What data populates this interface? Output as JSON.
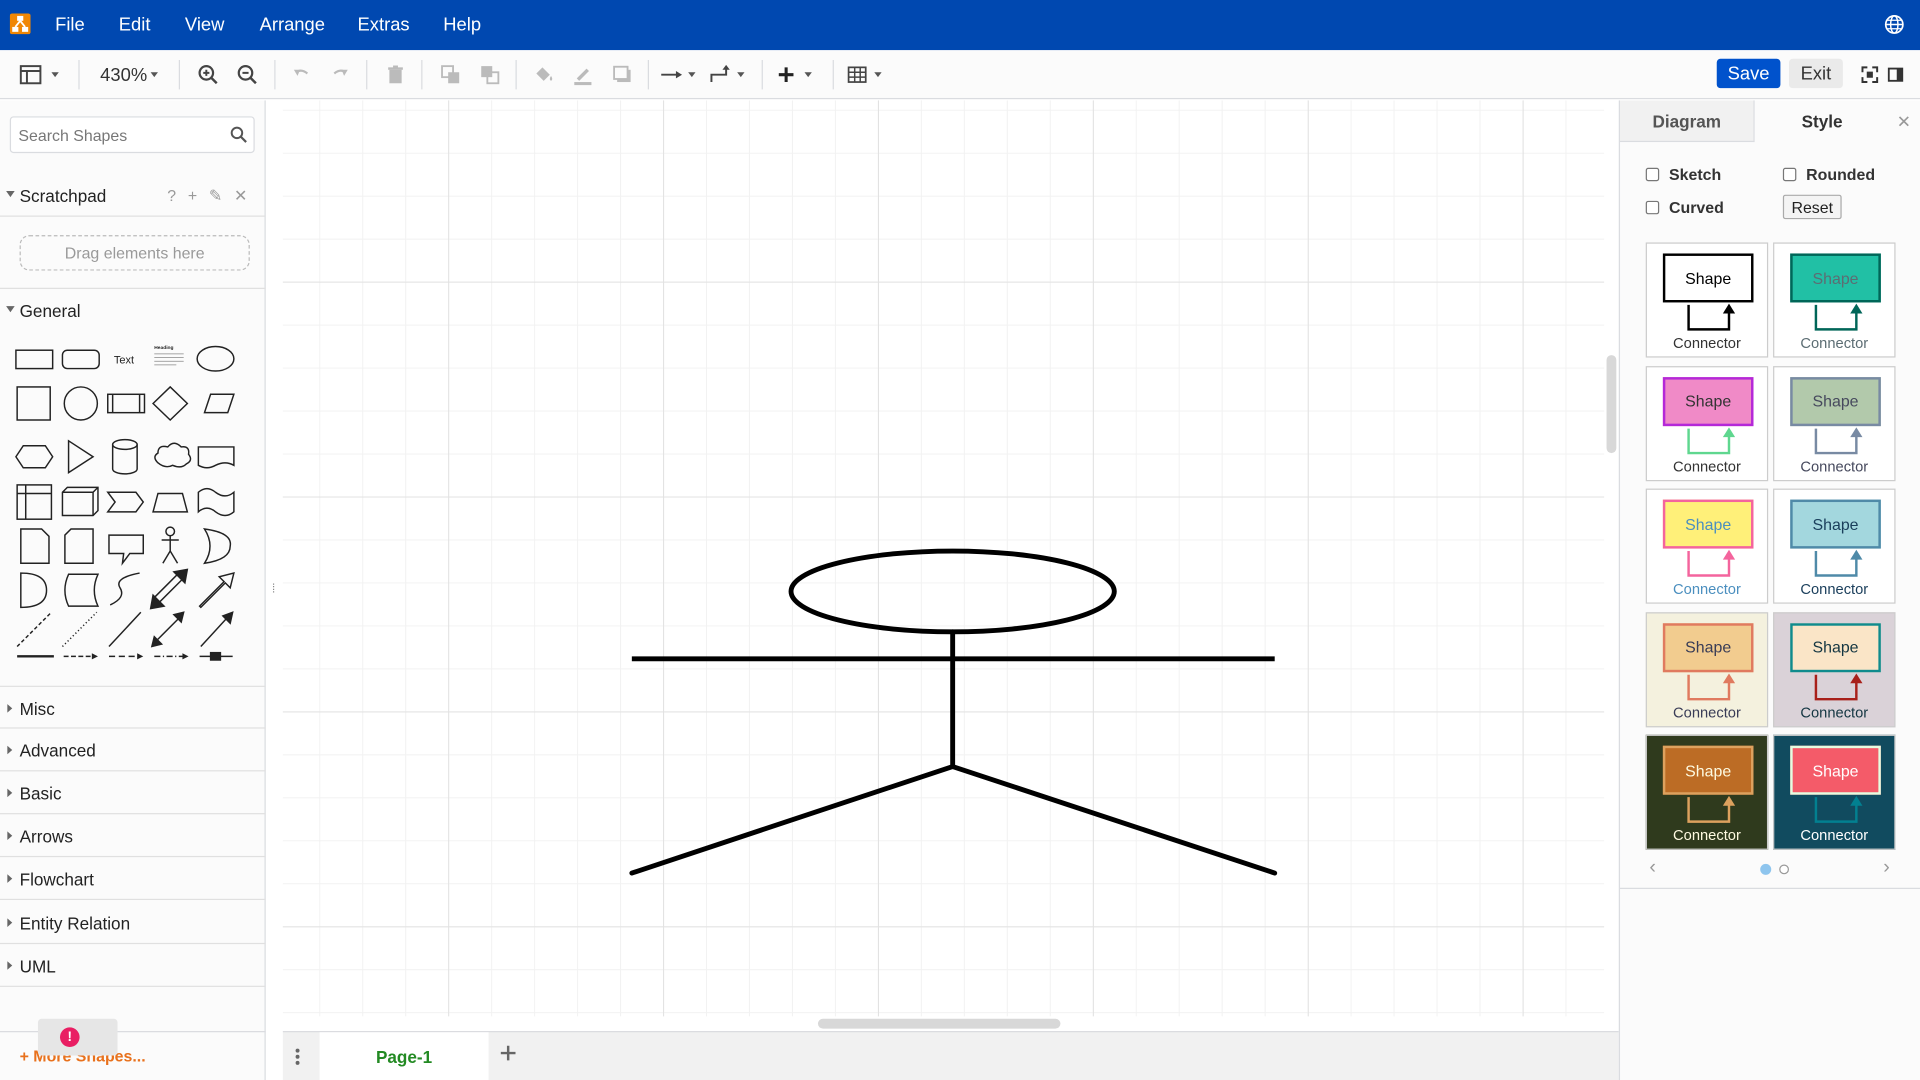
{
  "menubar": {
    "items": [
      "File",
      "Edit",
      "View",
      "Arrange",
      "Extras",
      "Help"
    ]
  },
  "toolbar": {
    "zoom": "430%",
    "save_label": "Save",
    "exit_label": "Exit"
  },
  "sidebar": {
    "search_placeholder": "Search Shapes",
    "scratchpad": {
      "label": "Scratchpad",
      "tools": "? + ✎ ✕",
      "drag_hint": "Drag elements here"
    },
    "general_label": "General",
    "text_shape_label": "Text",
    "heading_shape_label": "Heading",
    "sections": [
      "Misc",
      "Advanced",
      "Basic",
      "Arrows",
      "Flowchart",
      "Entity Relation",
      "UML"
    ],
    "more_shapes": "+ More Shapes..."
  },
  "pages": {
    "tabs": [
      "Page-1"
    ]
  },
  "format_panel": {
    "tabs": [
      "Diagram",
      "Style"
    ],
    "active_tab": "Style",
    "options": {
      "sketch": "Sketch",
      "rounded": "Rounded",
      "curved": "Curved",
      "reset": "Reset"
    },
    "swatches": [
      {
        "bg": "#ffffff",
        "fill": "#ffffff",
        "stroke": "#000000",
        "text": "#000000",
        "edge": "#000000",
        "label_color": "#333333",
        "shape": "Shape",
        "connector": "Connector"
      },
      {
        "bg": "#ffffff",
        "fill": "#21c0a5",
        "stroke": "#006658",
        "text": "#5c6d73",
        "edge": "#006658",
        "label_color": "#5c6d73",
        "shape": "Shape",
        "connector": "Connector"
      },
      {
        "bg": "#ffffff",
        "fill": "#f08ac7",
        "stroke": "#b428d8",
        "text": "#333333",
        "edge": "#5fd78f",
        "label_color": "#333333",
        "shape": "Shape",
        "connector": "Connector"
      },
      {
        "bg": "#ffffff",
        "fill": "#b2c9ab",
        "stroke": "#788aa3",
        "text": "#46495d",
        "edge": "#788aa3",
        "label_color": "#46495d",
        "shape": "Shape",
        "connector": "Connector"
      },
      {
        "bg": "#ffffff",
        "fill": "#fff079",
        "stroke": "#f4649d",
        "text": "#4b8fbf",
        "edge": "#f4649d",
        "label_color": "#4b8fbf",
        "shape": "Shape",
        "connector": "Connector"
      },
      {
        "bg": "#ffffff",
        "fill": "#a3d7de",
        "stroke": "#4f8aa8",
        "text": "#1a3e5b",
        "edge": "#4f8aa8",
        "label_color": "#1a3e5b",
        "shape": "Shape",
        "connector": "Connector"
      },
      {
        "bg": "#f4f1de",
        "fill": "#f2cc8f",
        "stroke": "#e07a5f",
        "text": "#393c56",
        "edge": "#e07a5f",
        "label_color": "#393c56",
        "shape": "Shape",
        "connector": "Connector"
      },
      {
        "bg": "#dad2d8",
        "fill": "#fae5c7",
        "stroke": "#0f8b8d",
        "text": "#143642",
        "edge": "#a8201a",
        "label_color": "#143642",
        "shape": "Shape",
        "connector": "Connector"
      },
      {
        "bg": "#2f3a1d",
        "fill": "#bc6c25",
        "stroke": "#dda15e",
        "text": "#fefae0",
        "edge": "#dda15e",
        "label_color": "#fefae0",
        "shape": "Shape",
        "connector": "Connector"
      },
      {
        "bg": "#114b5f",
        "fill": "#f45b69",
        "stroke": "#e4fde1",
        "text": "#ffffff",
        "edge": "#028090",
        "label_color": "#ffffff",
        "shape": "Shape",
        "connector": "Connector"
      }
    ]
  },
  "diagram": {
    "shape": "stick-figure-actor",
    "stroke": "#000000"
  }
}
